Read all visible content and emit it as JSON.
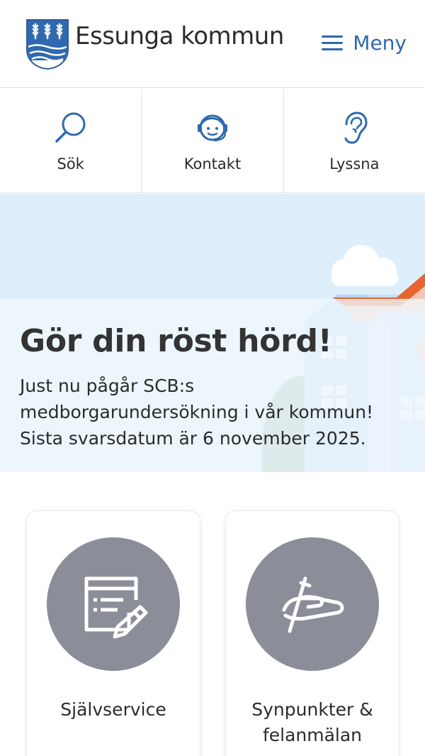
{
  "header": {
    "brand_name": "Essunga kommun",
    "menu_label": "Meny"
  },
  "quicknav": {
    "items": [
      {
        "label": "Sök",
        "icon": "search-icon"
      },
      {
        "label": "Kontakt",
        "icon": "headset-icon"
      },
      {
        "label": "Lyssna",
        "icon": "ear-icon"
      }
    ]
  },
  "hero": {
    "title": "Gör din röst hörd!",
    "text": "Just nu pågår SCB:s medborgarundersökning i vår kommun! Sista svarsdatum är 6 november 2025."
  },
  "cards": [
    {
      "label": "Självservice",
      "icon": "form-edit-icon"
    },
    {
      "label": "Synpunkter & felanmälan",
      "icon": "hand-pen-icon"
    }
  ],
  "colors": {
    "accent": "#2f69b0",
    "card_circle": "#8b8e99",
    "hero_bg": "#deeffb",
    "roof": "#e8642f"
  }
}
